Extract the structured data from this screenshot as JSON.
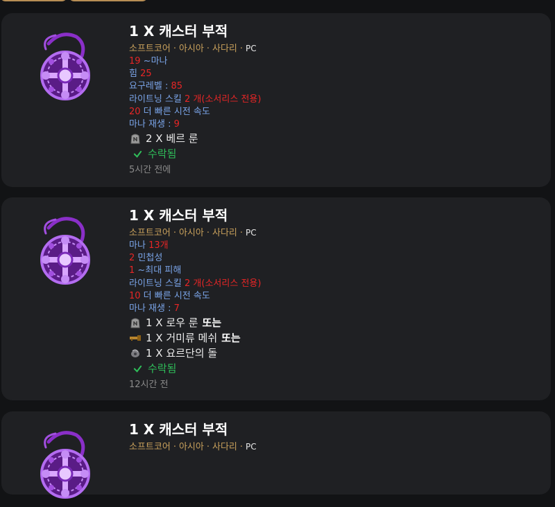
{
  "tabs": [
    {
      "label": ""
    },
    {
      "label": ""
    }
  ],
  "listings": [
    {
      "title": "1 X 캐스터 부적",
      "tags": [
        "소프트코어",
        "아시아",
        "사다리"
      ],
      "platform": "PC",
      "stats": [
        {
          "parts": [
            {
              "t": "19",
              "c": "red"
            },
            {
              "t": " ~마나",
              "c": "blue"
            }
          ]
        },
        {
          "parts": [
            {
              "t": "힘 ",
              "c": "blue"
            },
            {
              "t": "25",
              "c": "red"
            }
          ]
        },
        {
          "parts": [
            {
              "t": "요구레벨 : ",
              "c": "blue"
            },
            {
              "t": "85",
              "c": "red"
            }
          ]
        },
        {
          "parts": [
            {
              "t": "라이트닝 스킬 ",
              "c": "blue"
            },
            {
              "t": "2 개(소서리스 전용)",
              "c": "red"
            }
          ]
        },
        {
          "parts": [
            {
              "t": "20",
              "c": "red"
            },
            {
              "t": " 더 빠른 시전 속도",
              "c": "blue"
            }
          ]
        },
        {
          "parts": [
            {
              "t": "마나 재생 : ",
              "c": "blue"
            },
            {
              "t": "9",
              "c": "red"
            }
          ]
        }
      ],
      "wants": [
        {
          "icon": "rune",
          "text": "2 X 베르 룬",
          "or": ""
        }
      ],
      "status": "수락됨",
      "time": "5시간 전에"
    },
    {
      "title": "1 X 캐스터 부적",
      "tags": [
        "소프트코어",
        "아시아",
        "사다리"
      ],
      "platform": "PC",
      "stats": [
        {
          "parts": [
            {
              "t": "마나 ",
              "c": "blue"
            },
            {
              "t": "13개",
              "c": "red"
            }
          ]
        },
        {
          "parts": [
            {
              "t": "2",
              "c": "red"
            },
            {
              "t": " 민첩성",
              "c": "blue"
            }
          ]
        },
        {
          "parts": [
            {
              "t": "1",
              "c": "red"
            },
            {
              "t": " ~최대 피해",
              "c": "blue"
            }
          ]
        },
        {
          "parts": [
            {
              "t": "라이트닝 스킬 ",
              "c": "blue"
            },
            {
              "t": "2 개(소서리스 전용)",
              "c": "red"
            }
          ]
        },
        {
          "parts": [
            {
              "t": "10",
              "c": "red"
            },
            {
              "t": " 더 빠른 시전 속도",
              "c": "blue"
            }
          ]
        },
        {
          "parts": [
            {
              "t": "마나 재생 : ",
              "c": "blue"
            },
            {
              "t": "7",
              "c": "red"
            }
          ]
        }
      ],
      "wants": [
        {
          "icon": "rune",
          "text": "1 X 로우 룬",
          "or": "또는"
        },
        {
          "icon": "key",
          "text": "1 X 거미류 메쉬",
          "or": "또는"
        },
        {
          "icon": "stone",
          "text": "1 X 요르단의 돌",
          "or": ""
        }
      ],
      "status": "수락됨",
      "time": "12시간 전"
    },
    {
      "title": "1 X 캐스터 부적",
      "tags": [
        "소프트코어",
        "아시아",
        "사다리"
      ],
      "platform": "PC",
      "stats": [],
      "wants": [],
      "status": "",
      "time": ""
    }
  ]
}
